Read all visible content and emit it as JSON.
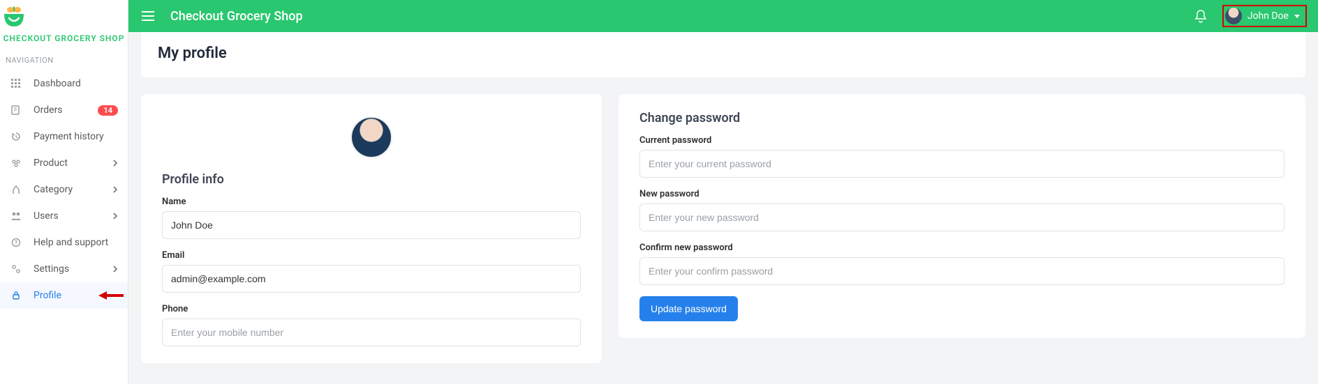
{
  "brand": {
    "name": "CHECKOUT GROCERY SHOP"
  },
  "nav": {
    "heading": "NAVIGATION",
    "items": [
      {
        "label": "Dashboard",
        "icon": "grid-icon"
      },
      {
        "label": "Orders",
        "icon": "orders-icon",
        "badge": "14"
      },
      {
        "label": "Payment history",
        "icon": "history-icon"
      },
      {
        "label": "Product",
        "icon": "product-icon",
        "chevron": true
      },
      {
        "label": "Category",
        "icon": "category-icon",
        "chevron": true
      },
      {
        "label": "Users",
        "icon": "users-icon",
        "chevron": true
      },
      {
        "label": "Help and support",
        "icon": "help-icon"
      },
      {
        "label": "Settings",
        "icon": "settings-icon",
        "chevron": true
      },
      {
        "label": "Profile",
        "icon": "lock-icon",
        "active": true,
        "arrow": true
      }
    ]
  },
  "header": {
    "title": "Checkout Grocery Shop",
    "user": "John Doe"
  },
  "page": {
    "title": "My profile"
  },
  "profile": {
    "section_title": "Profile info",
    "name_label": "Name",
    "name_value": "John Doe",
    "email_label": "Email",
    "email_value": "admin@example.com",
    "phone_label": "Phone",
    "phone_placeholder": "Enter your mobile number"
  },
  "password": {
    "section_title": "Change password",
    "current_label": "Current password",
    "current_placeholder": "Enter your current password",
    "new_label": "New password",
    "new_placeholder": "Enter your new password",
    "confirm_label": "Confirm new password",
    "confirm_placeholder": "Enter your confirm password",
    "button": "Update password"
  },
  "colors": {
    "primary_green": "#29c76f",
    "primary_blue": "#2680eb",
    "badge_red": "#ff4d4f",
    "highlight_border": "#d40000"
  }
}
